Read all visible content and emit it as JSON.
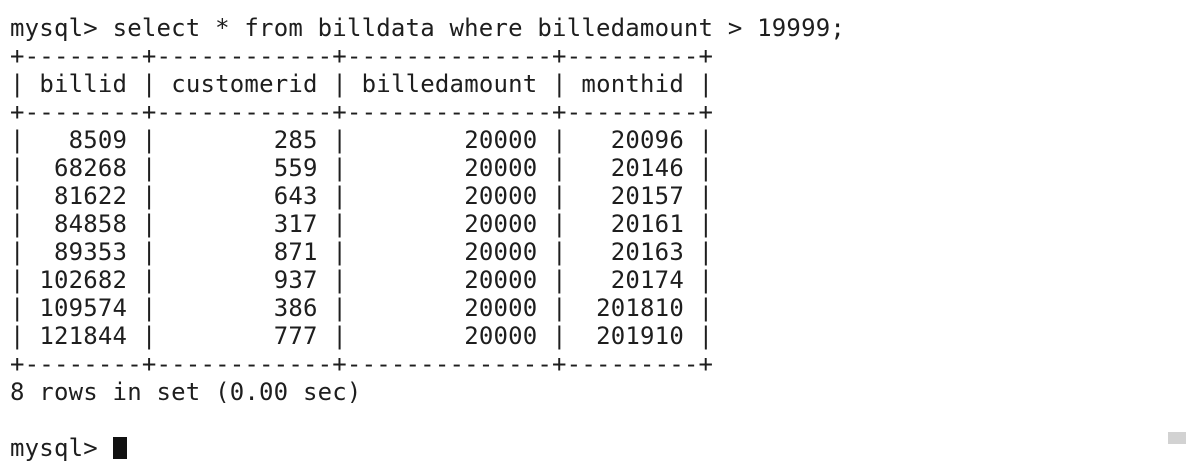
{
  "command": {
    "prompt": "mysql>",
    "text": "select * from billdata where billedamount > 19999;"
  },
  "table": {
    "columns": [
      "billid",
      "customerid",
      "billedamount",
      "monthid"
    ],
    "rows": [
      [
        "8509",
        "285",
        "20000",
        "20096"
      ],
      [
        "68268",
        "559",
        "20000",
        "20146"
      ],
      [
        "81622",
        "643",
        "20000",
        "20157"
      ],
      [
        "84858",
        "317",
        "20000",
        "20161"
      ],
      [
        "89353",
        "871",
        "20000",
        "20163"
      ],
      [
        "102682",
        "937",
        "20000",
        "20174"
      ],
      [
        "109574",
        "386",
        "20000",
        "201810"
      ],
      [
        "121844",
        "777",
        "20000",
        "201910"
      ]
    ]
  },
  "result_summary": "8 rows in set (0.00 sec)",
  "next_prompt": "mysql>"
}
